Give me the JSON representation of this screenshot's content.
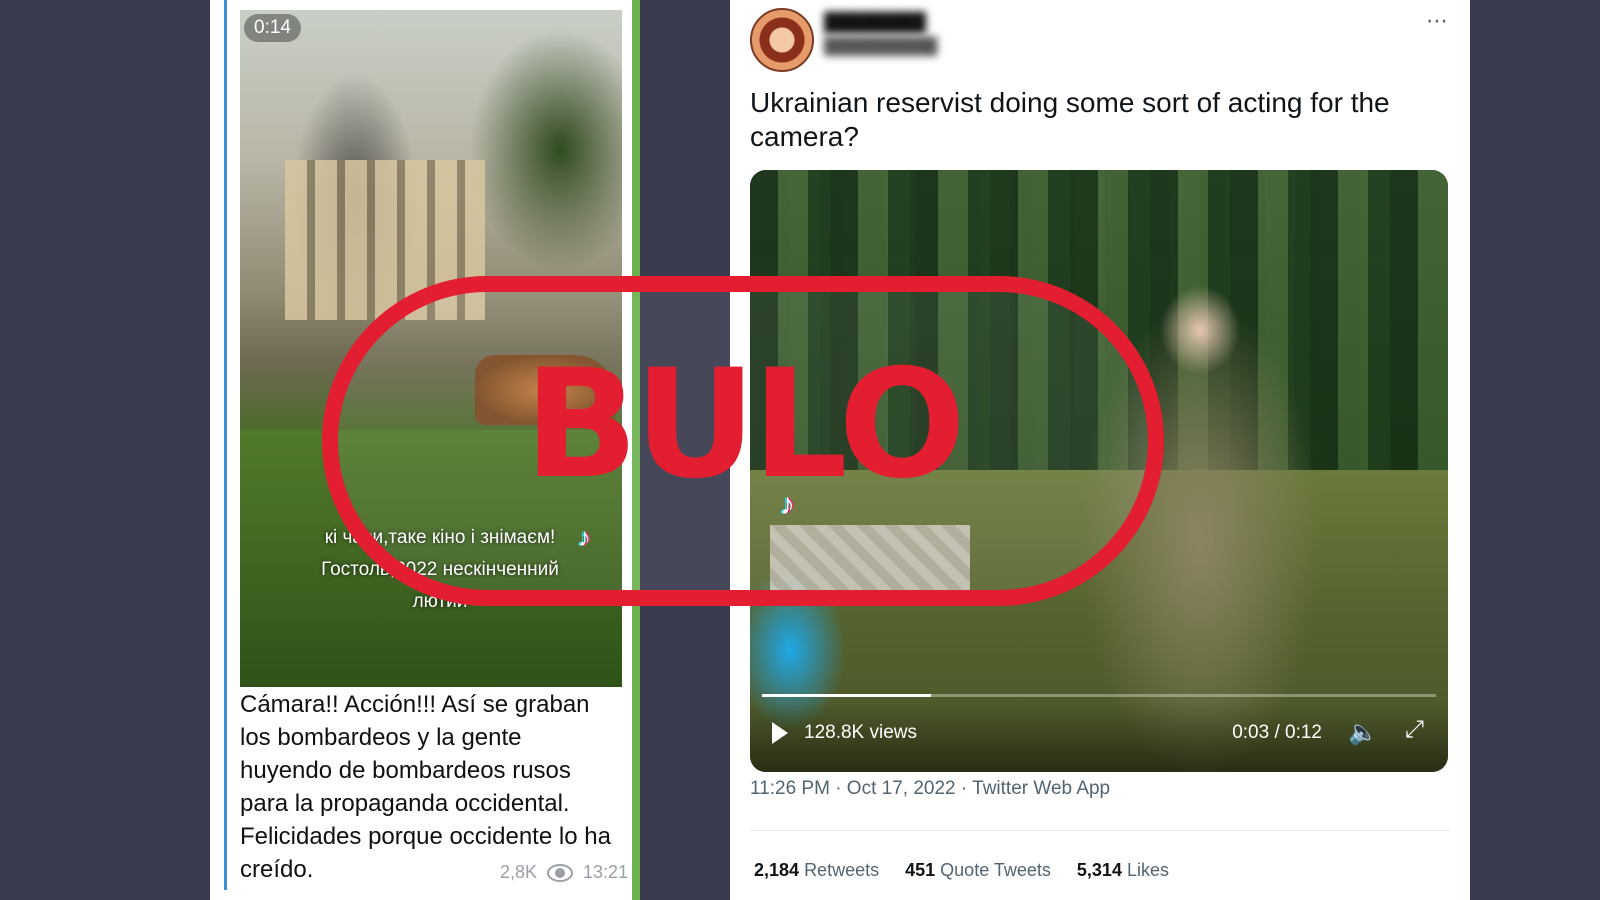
{
  "telegram_post": {
    "video_duration": "0:14",
    "video_overlay_text": "кі часи,таке кіно і знімаєм! Гостоль,2022 нескінченний лютий",
    "caption": "Cámara!! Acción!!! Así se graban los bombardeos y la gente huyendo de bombardeos rusos para la propaganda occidental. Felicidades porque occidente lo ha creído.",
    "views": "2,8K",
    "time": "13:21",
    "icons": {
      "views": "eye-icon",
      "watermark": "tiktok-icon"
    }
  },
  "tweet": {
    "text": "Ukrainian reservist doing some sort of acting for the camera?",
    "more_icon": "⋯",
    "video": {
      "views": "128.8K views",
      "time": "0:03 / 0:12",
      "progress": 0.25,
      "icons": {
        "play": "play-icon",
        "volume": "🔈",
        "fullscreen": "⤢"
      }
    },
    "meta": "11:26 PM · Oct 17, 2022 · Twitter Web App",
    "stats": {
      "retweets_count": "2,184",
      "retweets_label": "Retweets",
      "quotes_count": "451",
      "quotes_label": "Quote Tweets",
      "likes_count": "5,314",
      "likes_label": "Likes"
    }
  },
  "stamp": {
    "label": "BULO",
    "color": "#e31e30"
  }
}
